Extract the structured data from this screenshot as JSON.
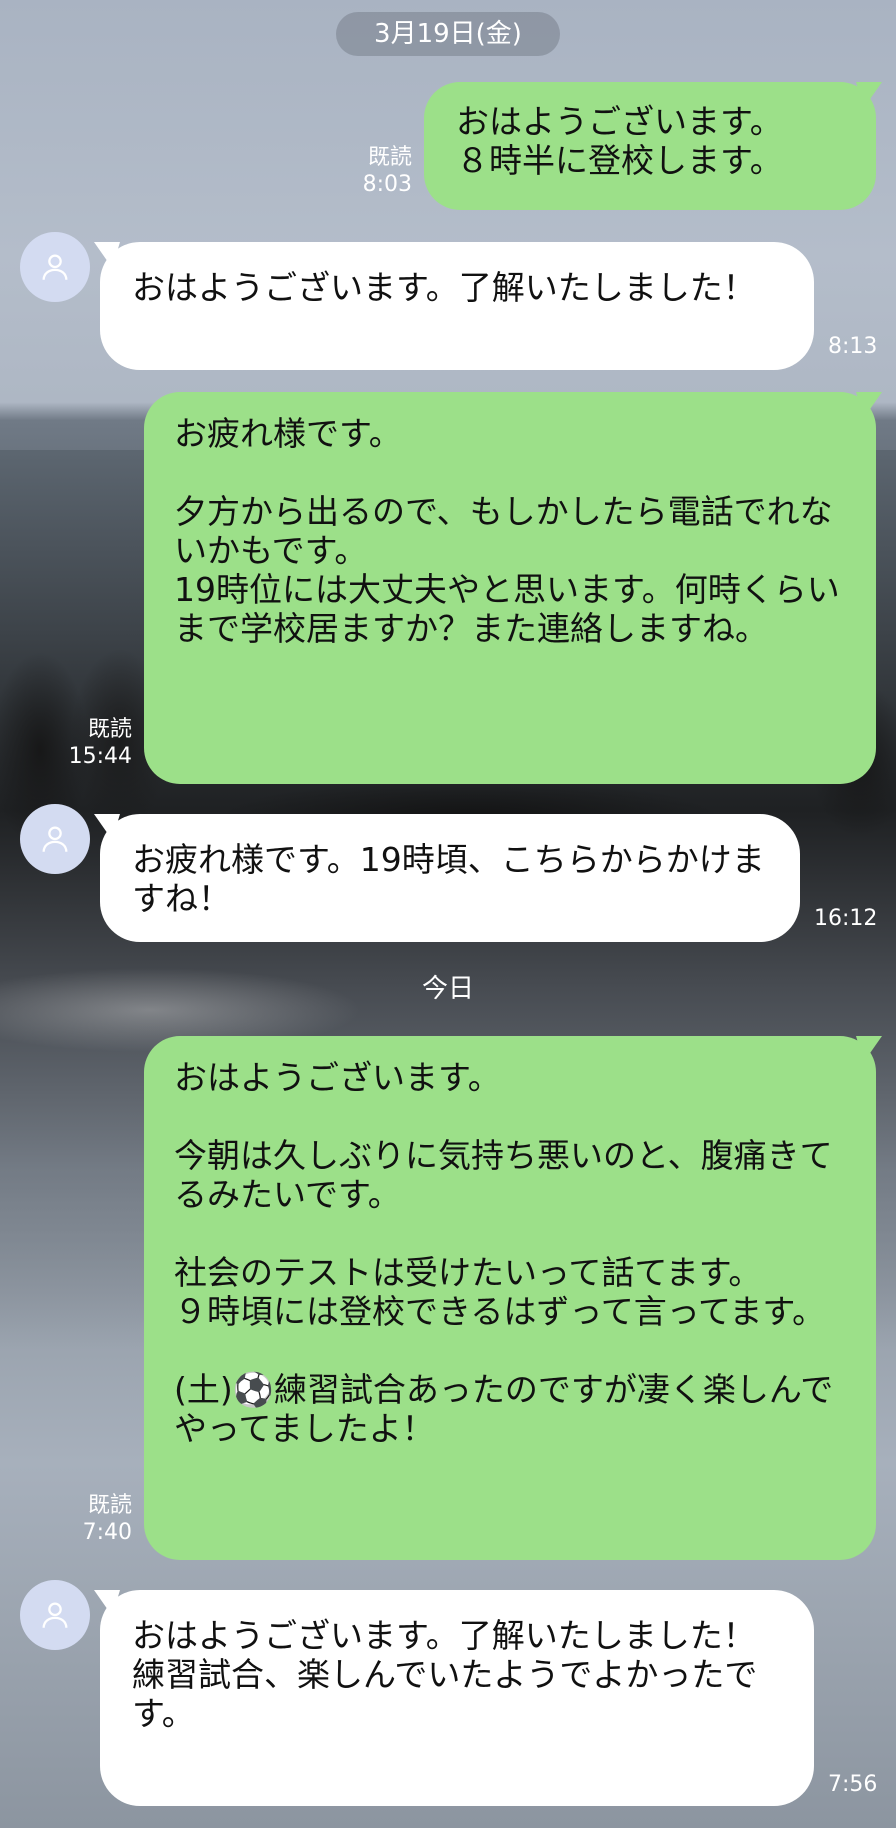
{
  "date_header": "3月19日(金)",
  "today_label": "今日",
  "messages": [
    {
      "side": "out",
      "text": "おはようございます。\n８時半に登校します。",
      "read": "既読",
      "time": "8:03"
    },
    {
      "side": "in",
      "text": "おはようございます。了解いたしました！",
      "time": "8:13"
    },
    {
      "side": "out",
      "text": "お疲れ様です。\n\n夕方から出るので、もしかしたら電話でれないかもです。\n19時位には大丈夫やと思います。何時くらいまで学校居ますか？また連絡しますね。",
      "read": "既読",
      "time": "15:44"
    },
    {
      "side": "in",
      "text": "お疲れ様です。19時頃、こちらからかけますね！",
      "time": "16:12"
    },
    {
      "side": "out",
      "text": "おはようございます。\n\n今朝は久しぶりに気持ち悪いのと、腹痛きてるみたいです。\n\n社会のテストは受けたいって話てます。\n９時頃には登校できるはずって言ってます。\n\n(土)⚽練習試合あったのですが凄く楽しんでやってましたよ！",
      "read": "既読",
      "time": "7:40"
    },
    {
      "side": "in",
      "text": "おはようございます。了解いたしました！\n練習試合、楽しんでいたようでよかったです。",
      "time": "7:56"
    }
  ],
  "icons": {
    "avatar": "person-silhouette-icon"
  }
}
